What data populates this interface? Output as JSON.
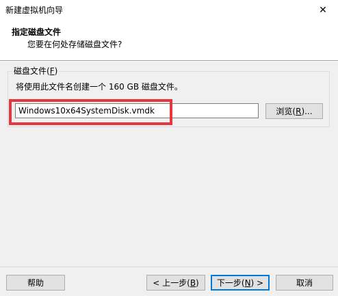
{
  "window": {
    "title": "新建虚拟机向导",
    "close_glyph": "✕"
  },
  "header": {
    "title": "指定磁盘文件",
    "subtitle": "您要在何处存储磁盘文件?"
  },
  "disk_file_group": {
    "legend_text": "磁盘文件(",
    "legend_accel": "F",
    "legend_close": ")",
    "description": "将使用此文件名创建一个 160 GB 磁盘文件。",
    "file_name_value": "Windows10x64SystemDisk.vmdk",
    "browse_text": "浏览(",
    "browse_accel": "R",
    "browse_close": ")..."
  },
  "footer": {
    "help_label": "帮助",
    "back_text": "< 上一步(",
    "back_accel": "B",
    "back_close": ")",
    "next_text": "下一步(",
    "next_accel": "N",
    "next_close": ") >",
    "cancel_label": "取消"
  },
  "colors": {
    "highlight": "#e8363c",
    "default_button_border": "#0078d7"
  }
}
